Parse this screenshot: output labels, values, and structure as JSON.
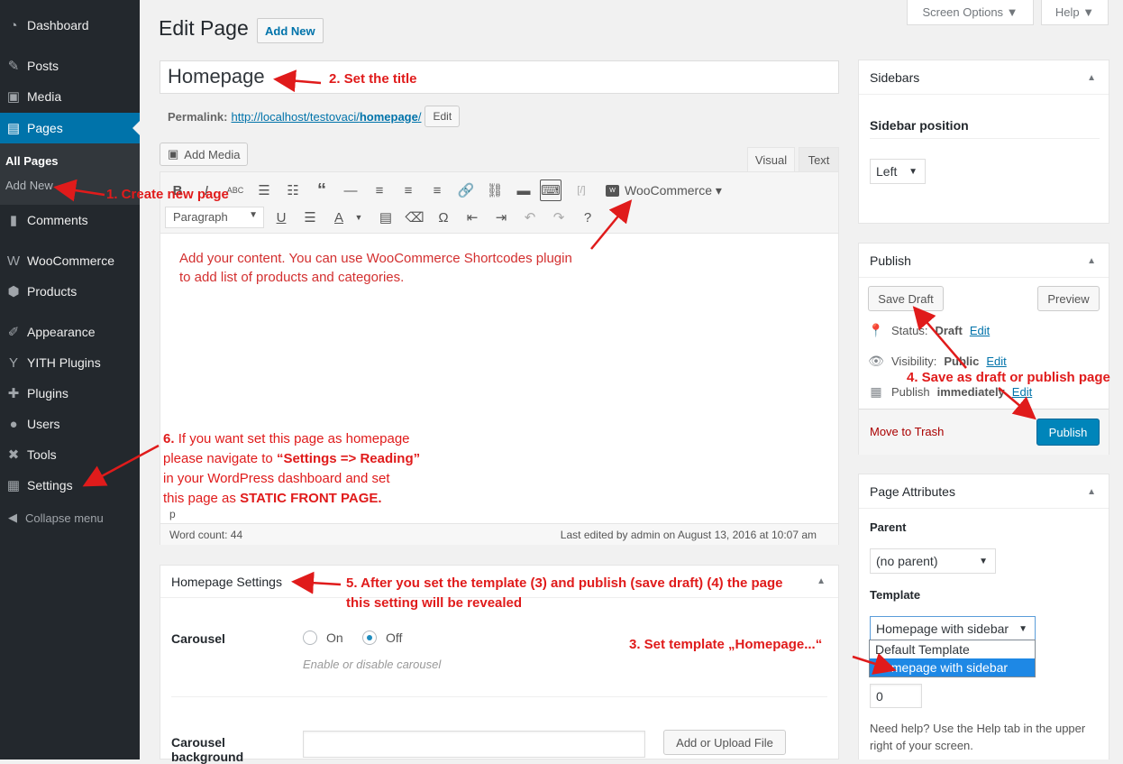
{
  "admin_menu": {
    "items": [
      {
        "label": "Dashboard",
        "icon": "dashboard-icon",
        "glyph": "◔"
      },
      {
        "label": "Posts",
        "icon": "pin-icon",
        "glyph": "✎"
      },
      {
        "label": "Media",
        "icon": "media-icon",
        "glyph": "▣"
      },
      {
        "label": "Pages",
        "icon": "pages-icon",
        "glyph": "▤"
      },
      {
        "label": "Comments",
        "icon": "comment-icon",
        "glyph": "▮"
      },
      {
        "label": "WooCommerce",
        "icon": "woocommerce-icon",
        "glyph": "W"
      },
      {
        "label": "Products",
        "icon": "products-icon",
        "glyph": "⬢"
      },
      {
        "label": "Appearance",
        "icon": "appearance-icon",
        "glyph": "✐"
      },
      {
        "label": "YITH Plugins",
        "icon": "yith-icon",
        "glyph": "Y"
      },
      {
        "label": "Plugins",
        "icon": "plugins-icon",
        "glyph": "✚"
      },
      {
        "label": "Users",
        "icon": "users-icon",
        "glyph": "●"
      },
      {
        "label": "Tools",
        "icon": "tools-icon",
        "glyph": "✖"
      },
      {
        "label": "Settings",
        "icon": "settings-icon",
        "glyph": "▦"
      }
    ],
    "submenu": {
      "all_pages": "All Pages",
      "add_new": "Add New"
    },
    "collapse": "Collapse menu"
  },
  "screen_meta": {
    "screen_options": "Screen Options ▼",
    "help": "Help ▼"
  },
  "header": {
    "title": "Edit Page",
    "add_new": "Add New"
  },
  "post": {
    "title": "Homepage",
    "permalink_label": "Permalink:",
    "permalink_base": "http://localhost/testovaci/",
    "permalink_slug": "homepage",
    "permalink_end": "/",
    "permalink_edit": "Edit"
  },
  "editor": {
    "add_media": "Add Media",
    "tab_visual": "Visual",
    "tab_text": "Text",
    "format_select": "Paragraph",
    "woocommerce_button": "WooCommerce ▾",
    "content_line1": "Add your content. You can use WooCommerce Shortcodes plugin",
    "content_line2": "to add list of products and categories.",
    "path": "p",
    "word_count": "Word count: 44",
    "last_edited": "Last edited by admin on August 13, 2016 at 10:07 am"
  },
  "homepage_settings": {
    "title": "Homepage Settings",
    "carousel_label": "Carousel",
    "on_label": "On",
    "off_label": "Off",
    "carousel_value": "Off",
    "carousel_desc": "Enable or disable carousel",
    "bg_label": "Carousel background",
    "upload_btn": "Add or Upload File"
  },
  "sidebars_box": {
    "title": "Sidebars",
    "position_label": "Sidebar position",
    "position_value": "Left"
  },
  "publish_box": {
    "title": "Publish",
    "save_draft": "Save Draft",
    "preview": "Preview",
    "status_label": "Status:",
    "status_value": "Draft",
    "visibility_label": "Visibility:",
    "visibility_value": "Public",
    "publish_label": "Publish",
    "publish_value": "immediately",
    "edit": "Edit",
    "move_to_trash": "Move to Trash",
    "publish_btn": "Publish"
  },
  "page_attributes": {
    "title": "Page Attributes",
    "parent_label": "Parent",
    "parent_value": "(no parent)",
    "template_label": "Template",
    "template_value": "Homepage with sidebar",
    "template_options": [
      "Default Template",
      "Homepage with sidebar"
    ],
    "order_value": "0",
    "help_text": "Need help? Use the Help tab in the upper right of your screen."
  },
  "annotations": {
    "a1": "1. Create new page",
    "a2": "2. Set the title",
    "a3": "3. Set template „Homepage...“",
    "a4": "4. Save as draft or publish page",
    "a5_line1": "5. After you set the template (3) and publish (save draft) (4) the page",
    "a5_line2": "this setting will be revealed",
    "a6_num": "6.",
    "a6_l1": "If you want set this page as homepage",
    "a6_l2a": "please navigate to ",
    "a6_l2b": "“Settings => Reading”",
    "a6_l3": "in your WordPress dashboard and set",
    "a6_l4a": "this page as ",
    "a6_l4b": "STATIC FRONT PAGE."
  },
  "colors": {
    "admin_bg": "#23282d",
    "accent": "#0073aa",
    "annotation": "#e01b1b",
    "primary_button": "#0085ba"
  }
}
